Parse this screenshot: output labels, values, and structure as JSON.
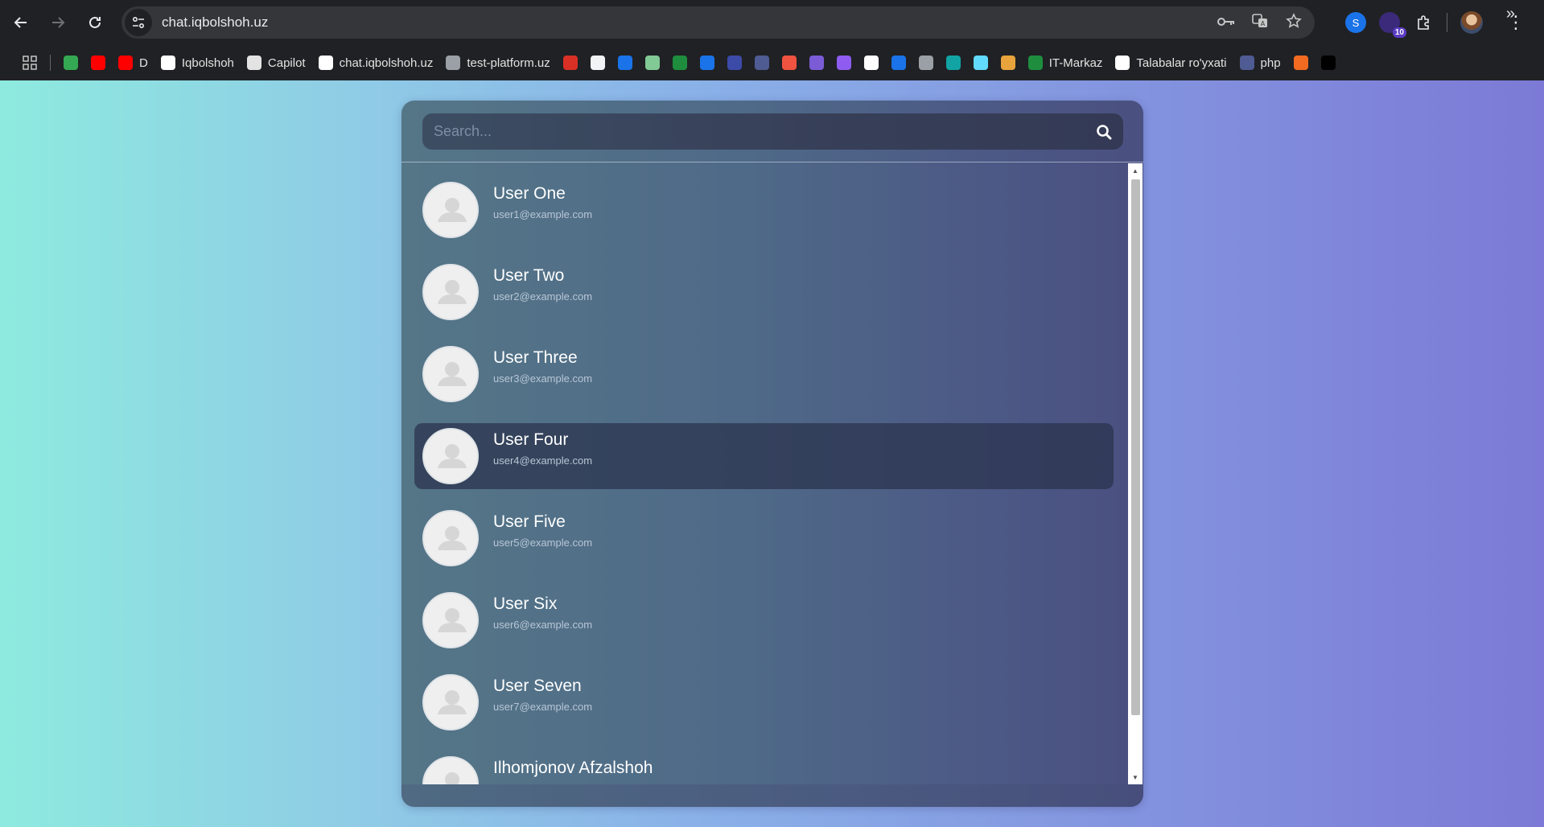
{
  "browser": {
    "url": "chat.iqbolshoh.uz",
    "extension_badge": "10",
    "bookmarks": [
      {
        "label": "",
        "icon": "maps-icon",
        "color": "#34a853"
      },
      {
        "label": "",
        "icon": "youtube-icon",
        "color": "#ff0000"
      },
      {
        "label": "D",
        "icon": "youtube-icon",
        "color": "#ff0000"
      },
      {
        "label": "Iqbolshoh",
        "icon": "github-icon",
        "color": "#ffffff"
      },
      {
        "label": "Capilot",
        "icon": "copilot-icon",
        "color": "#e3e3e3"
      },
      {
        "label": "chat.iqbolshoh.uz",
        "icon": "code-icon",
        "color": "#ffffff"
      },
      {
        "label": "test-platform.uz",
        "icon": "globe-icon",
        "color": "#9aa0a6"
      },
      {
        "label": "",
        "icon": "gauge-icon",
        "color": "#d93025"
      },
      {
        "label": "",
        "icon": "flag-icon",
        "color": "#f1f3f4"
      },
      {
        "label": "",
        "icon": "ring-icon",
        "color": "#1a73e8"
      },
      {
        "label": "",
        "icon": "people-icon",
        "color": "#81c995"
      },
      {
        "label": "",
        "icon": "xp-icon",
        "color": "#1e8e3e"
      },
      {
        "label": "",
        "icon": "chat-bubble-icon",
        "color": "#1a73e8"
      },
      {
        "label": "",
        "icon": "arrow-circle-icon",
        "color": "#3c4aa8"
      },
      {
        "label": "",
        "icon": "php-icon",
        "color": "#4f5b93"
      },
      {
        "label": "",
        "icon": "laravel-icon",
        "color": "#f05340"
      },
      {
        "label": "",
        "icon": "shield-icon",
        "color": "#7b5cd6"
      },
      {
        "label": "",
        "icon": "drop-icon",
        "color": "#8e5cf0"
      },
      {
        "label": "",
        "icon": "openai-icon",
        "color": "#ffffff"
      },
      {
        "label": "",
        "icon": "c-circle-icon",
        "color": "#1a73e8"
      },
      {
        "label": "",
        "icon": "robot-icon",
        "color": "#9aa0a6"
      },
      {
        "label": "",
        "icon": "diamond-icon",
        "color": "#12a4a4"
      },
      {
        "label": "",
        "icon": "react-icon",
        "color": "#61dafb"
      },
      {
        "label": "",
        "icon": "sail-icon",
        "color": "#e8a33d"
      },
      {
        "label": "IT-Markaz",
        "icon": "plus-square-icon",
        "color": "#1e8e3e"
      },
      {
        "label": "Talabalar ro'yxati",
        "icon": "code-icon",
        "color": "#ffffff"
      },
      {
        "label": "php",
        "icon": "php-icon",
        "color": "#4f5b93"
      },
      {
        "label": "",
        "icon": "orange-icon",
        "color": "#f26b21"
      },
      {
        "label": "",
        "icon": "m-icon",
        "color": "#000000"
      }
    ]
  },
  "search": {
    "placeholder": "Search...",
    "value": ""
  },
  "users": [
    {
      "name": "User One",
      "email": "user1@example.com",
      "active": false
    },
    {
      "name": "User Two",
      "email": "user2@example.com",
      "active": false
    },
    {
      "name": "User Three",
      "email": "user3@example.com",
      "active": false
    },
    {
      "name": "User Four",
      "email": "user4@example.com",
      "active": true
    },
    {
      "name": "User Five",
      "email": "user5@example.com",
      "active": false
    },
    {
      "name": "User Six",
      "email": "user6@example.com",
      "active": false
    },
    {
      "name": "User Seven",
      "email": "user7@example.com",
      "active": false
    },
    {
      "name": "Ilhomjonov Afzalshoh",
      "email": "",
      "active": false
    }
  ]
}
